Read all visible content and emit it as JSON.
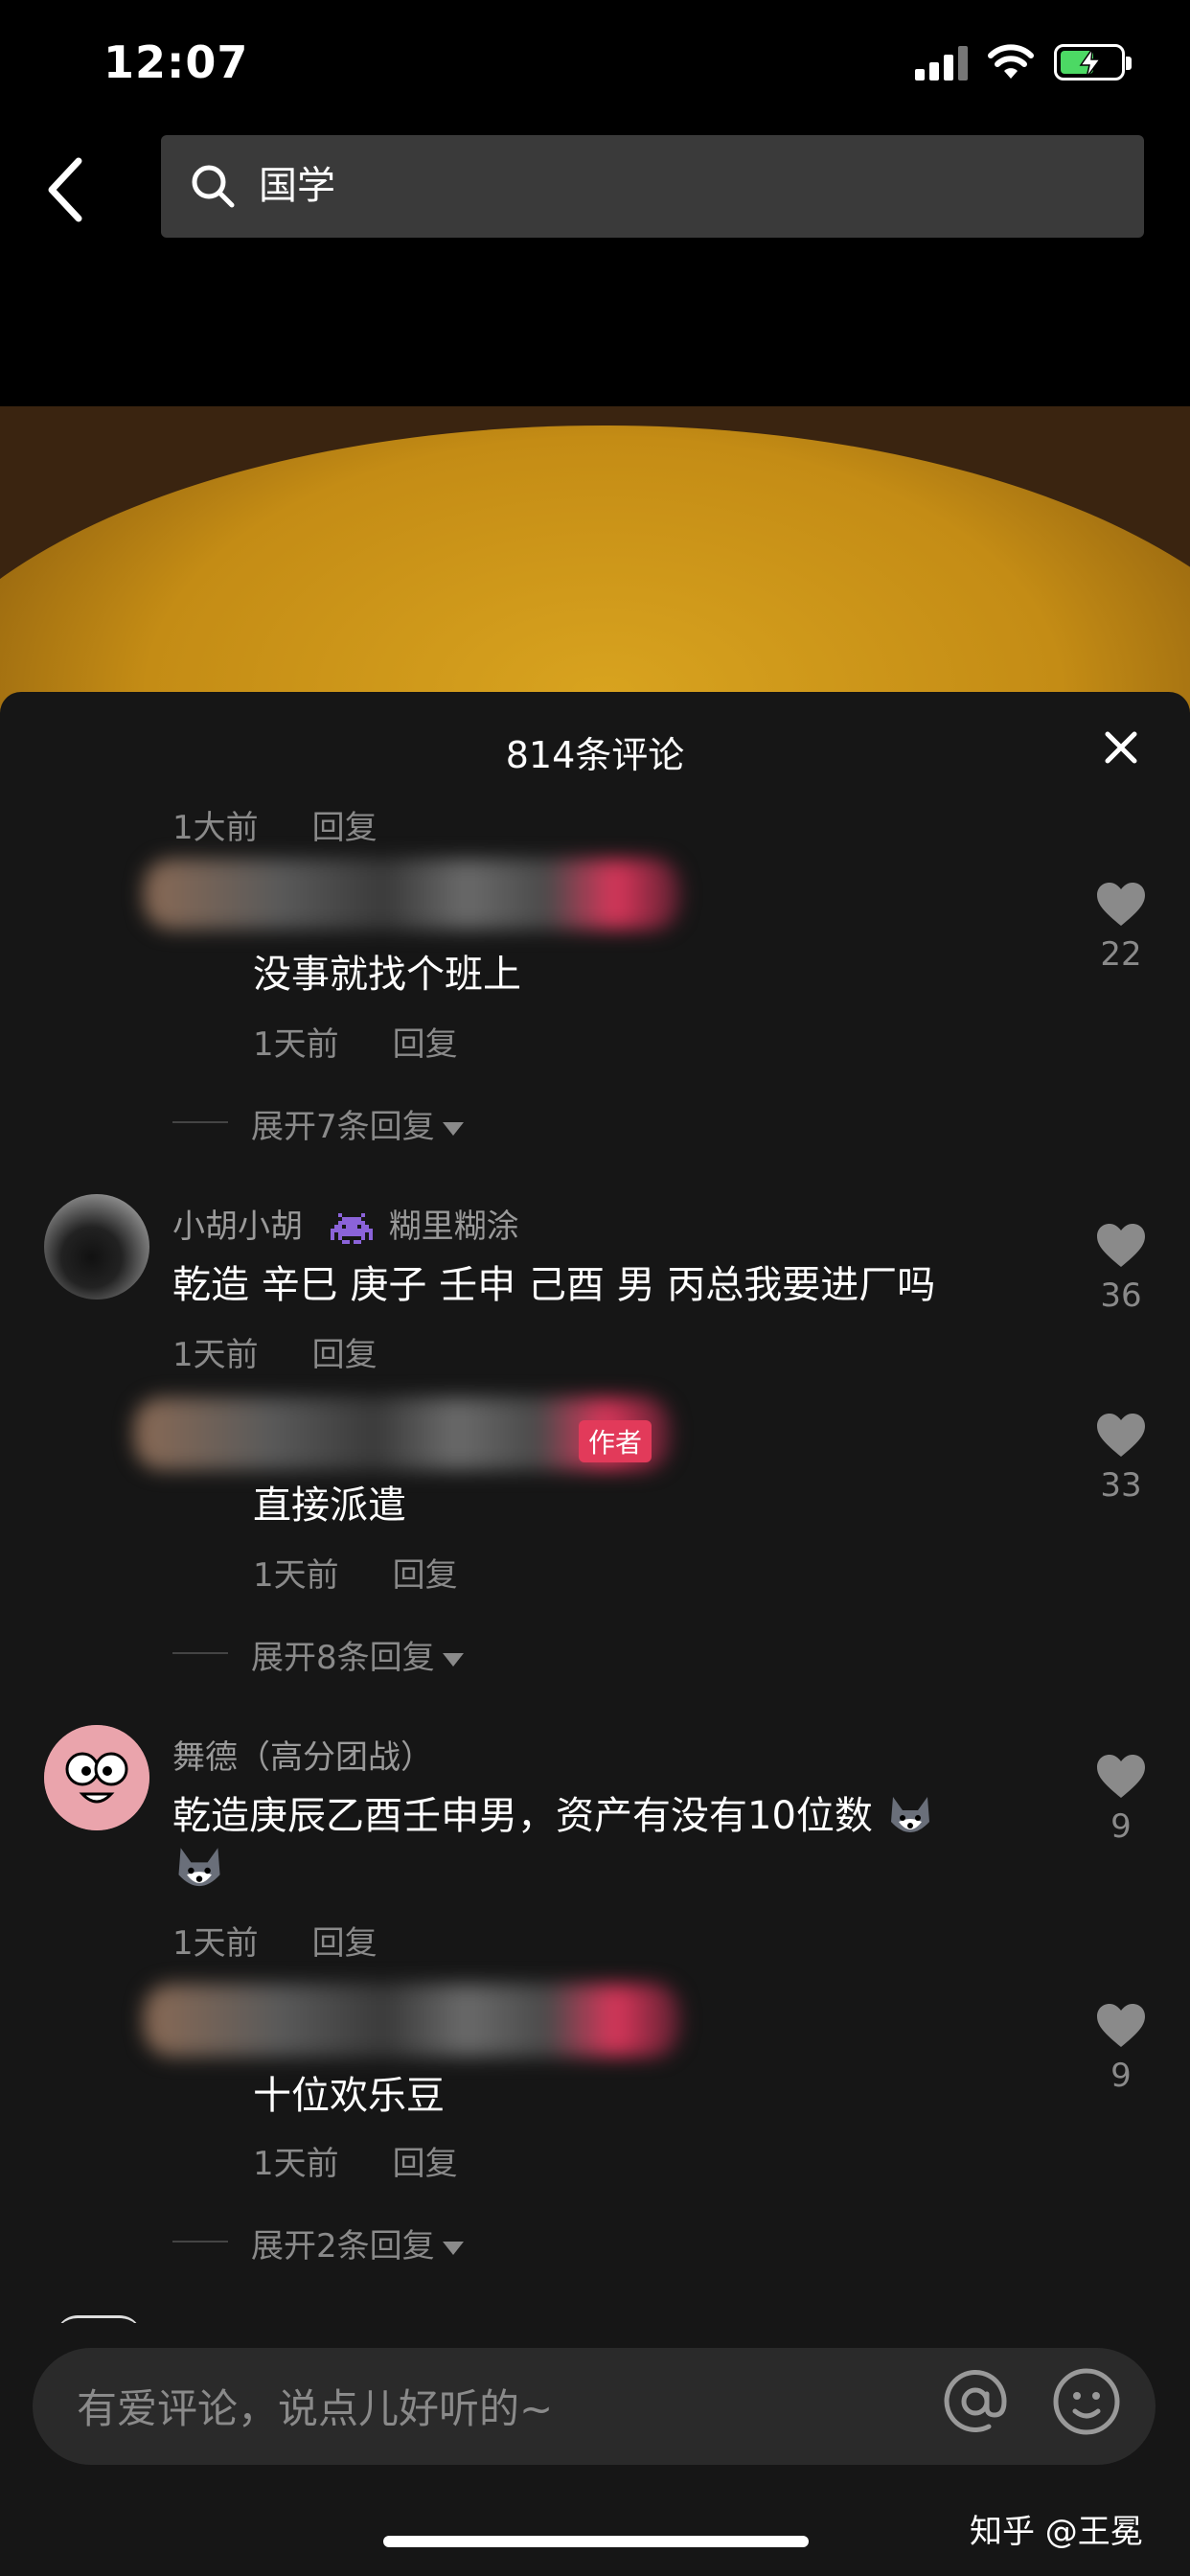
{
  "status_bar": {
    "time": "12:07",
    "battery_color": "#4cd964"
  },
  "search": {
    "query": "国学"
  },
  "comments_panel": {
    "title": "814条评论",
    "reply_label": "回复",
    "top_partial": {
      "time": "1大前"
    },
    "threads": [
      {
        "reply": {
          "text": "没事就找个班上",
          "time": "1天前",
          "likes": "22"
        },
        "expand": "展开7条回复"
      },
      {
        "comment": {
          "author": "小胡小胡",
          "tag_icon": "space-invader-icon",
          "tag": "糊里糊涂",
          "text": "乾造 辛巳 庚子 壬申 己酉 男 丙总我要进厂吗",
          "time": "1天前",
          "likes": "36"
        },
        "reply": {
          "badge": "作者",
          "text": "直接派遣",
          "time": "1天前",
          "likes": "33"
        },
        "expand": "展开8条回复"
      },
      {
        "comment": {
          "author": "舞德（高分团战）",
          "text": "乾造庚辰乙酉壬申男，资产有没有10位数",
          "time": "1天前",
          "likes": "9"
        },
        "reply": {
          "text": "十位欢乐豆",
          "time": "1天前",
          "likes": "9"
        },
        "expand": "展开2条回复"
      }
    ]
  },
  "input": {
    "placeholder": "有爱评论，说点儿好听的~"
  },
  "watermark": "知乎 @王冕"
}
